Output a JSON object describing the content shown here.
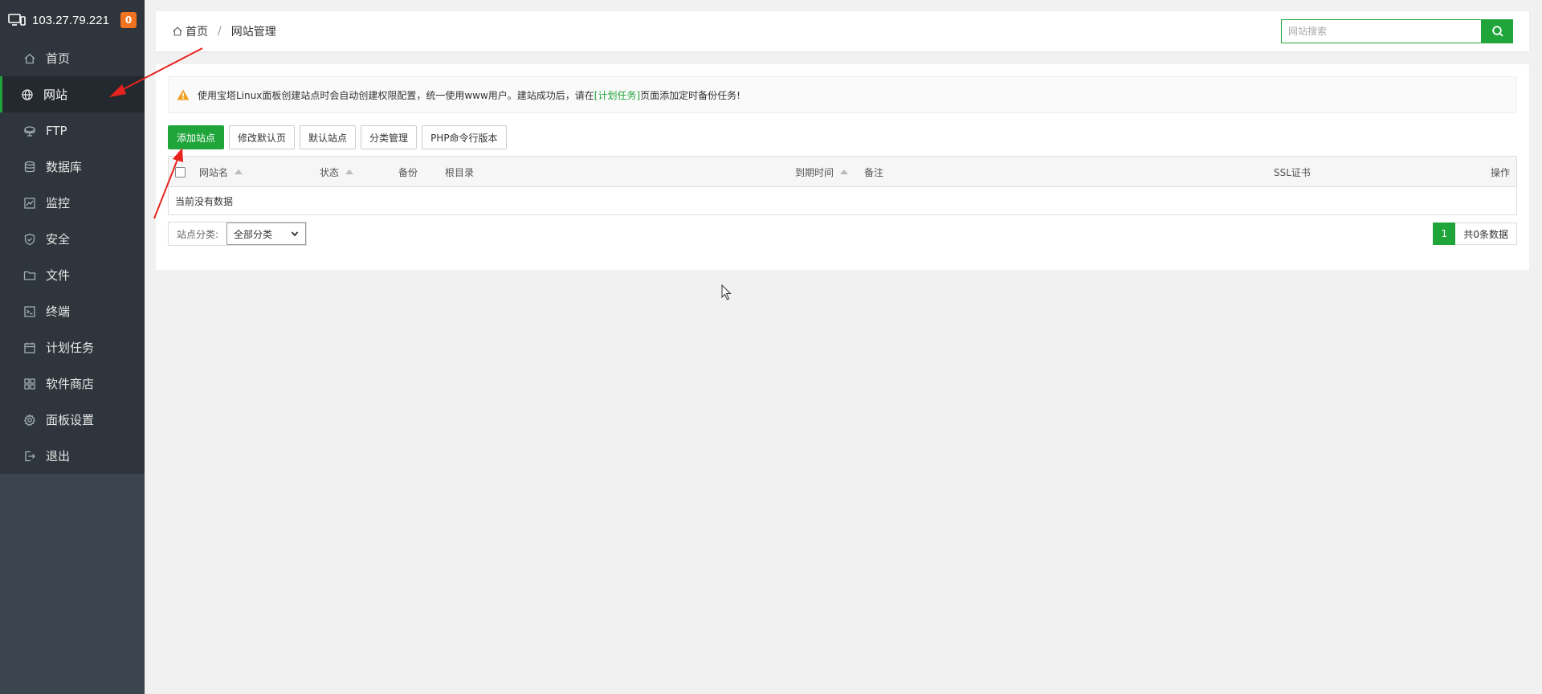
{
  "sidebar": {
    "ip": "103.27.79.221",
    "badge": "0",
    "items": [
      {
        "label": "首页",
        "icon": "home-icon"
      },
      {
        "label": "网站",
        "icon": "globe-icon",
        "active": true
      },
      {
        "label": "FTP",
        "icon": "ftp-icon"
      },
      {
        "label": "数据库",
        "icon": "database-icon"
      },
      {
        "label": "监控",
        "icon": "monitor-chart-icon"
      },
      {
        "label": "安全",
        "icon": "shield-icon"
      },
      {
        "label": "文件",
        "icon": "folder-icon"
      },
      {
        "label": "终端",
        "icon": "terminal-icon"
      },
      {
        "label": "计划任务",
        "icon": "calendar-icon"
      },
      {
        "label": "软件商店",
        "icon": "apps-grid-icon"
      },
      {
        "label": "面板设置",
        "icon": "gear-icon"
      },
      {
        "label": "退出",
        "icon": "logout-icon"
      }
    ]
  },
  "header": {
    "breadcrumb_home": "首页",
    "breadcrumb_separator": "/",
    "breadcrumb_current": "网站管理",
    "search_placeholder": "网站搜索"
  },
  "alert": {
    "text_before": "使用宝塔Linux面板创建站点时会自动创建权限配置，统一使用www用户。建站成功后，请在",
    "link": "[计划任务]",
    "text_after": "页面添加定时备份任务!"
  },
  "toolbar": {
    "add_site": "添加站点",
    "modify_default_page": "修改默认页",
    "default_site": "默认站点",
    "category_manage": "分类管理",
    "php_cli_version": "PHP命令行版本"
  },
  "table": {
    "columns": {
      "name": "网站名",
      "status": "状态",
      "backup": "备份",
      "root": "根目录",
      "expire": "到期时间",
      "remark": "备注",
      "ssl": "SSL证书",
      "action": "操作"
    },
    "empty_text": "当前没有数据"
  },
  "footer": {
    "category_label": "站点分类:",
    "category_selected": "全部分类",
    "page": "1",
    "total": "共0条数据"
  },
  "colors": {
    "accent": "#20a53a",
    "sidebar_bg": "#3c444d",
    "badge": "#f0731f",
    "annotation_arrow": "#e8231e"
  }
}
